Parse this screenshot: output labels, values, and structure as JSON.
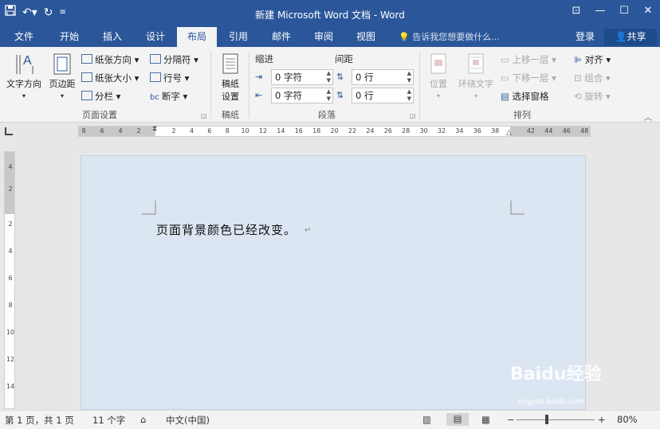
{
  "title": "新建 Microsoft Word 文档 - Word",
  "quick_access": {
    "save_icon": "save-icon",
    "undo_icon": "undo-icon",
    "redo_icon": "redo-icon",
    "customize_icon": "customize-icon"
  },
  "window_controls": {
    "ribbon_options": "ribbon-display-icon",
    "minimize": "minimize-icon",
    "maximize": "maximize-icon",
    "close": "close-icon"
  },
  "tabs": [
    "文件",
    "开始",
    "插入",
    "设计",
    "布局",
    "引用",
    "邮件",
    "审阅",
    "视图"
  ],
  "active_tab": "布局",
  "tell_me": "告诉我您想要做什么...",
  "login": "登录",
  "share": "共享",
  "ribbon": {
    "page_setup": {
      "label": "页面设置",
      "text_direction": "文字方向",
      "margins": "页边距",
      "orientation": "纸张方向",
      "size": "纸张大小",
      "columns": "分栏",
      "breaks": "分隔符",
      "line_numbers": "行号",
      "hyphenation": "断字"
    },
    "manuscript": {
      "label": "稿纸",
      "button": "稿纸\n设置"
    },
    "paragraph": {
      "label": "段落",
      "indent": "缩进",
      "spacing": "间距",
      "indent_left": "0 字符",
      "indent_right": "0 字符",
      "space_before": "0 行",
      "space_after": "0 行"
    },
    "arrange": {
      "label": "排列",
      "position": "位置",
      "wrap_text": "环绕文字",
      "bring_forward": "上移一层",
      "send_backward": "下移一层",
      "selection_pane": "选择窗格",
      "align": "对齐",
      "group": "组合",
      "rotate": "旋转"
    }
  },
  "ruler": {
    "left_numbers": [
      "8",
      "6",
      "4",
      "2"
    ],
    "right_numbers": [
      "2",
      "4",
      "6",
      "8",
      "10",
      "12",
      "14",
      "16",
      "18",
      "20",
      "22",
      "24",
      "26",
      "28",
      "30",
      "32",
      "34",
      "36",
      "38"
    ],
    "far_numbers": [
      "42",
      "44",
      "46",
      "48"
    ],
    "vertical_numbers": [
      "4",
      "2",
      "2",
      "4",
      "6",
      "8",
      "10",
      "12",
      "14"
    ]
  },
  "document": {
    "text": "页面背景颜色已经改变。",
    "background": "#dce6f2"
  },
  "status": {
    "page": "第 1 页，共 1 页",
    "words": "11 个字",
    "language": "中文(中国)",
    "zoom": "80%"
  },
  "watermark": {
    "text": "Baidu经验",
    "sub": "jingyan.baidu.com"
  },
  "colors": {
    "accent": "#2b579a",
    "ribbon": "#f3f3f3",
    "page": "#dce6f2"
  }
}
